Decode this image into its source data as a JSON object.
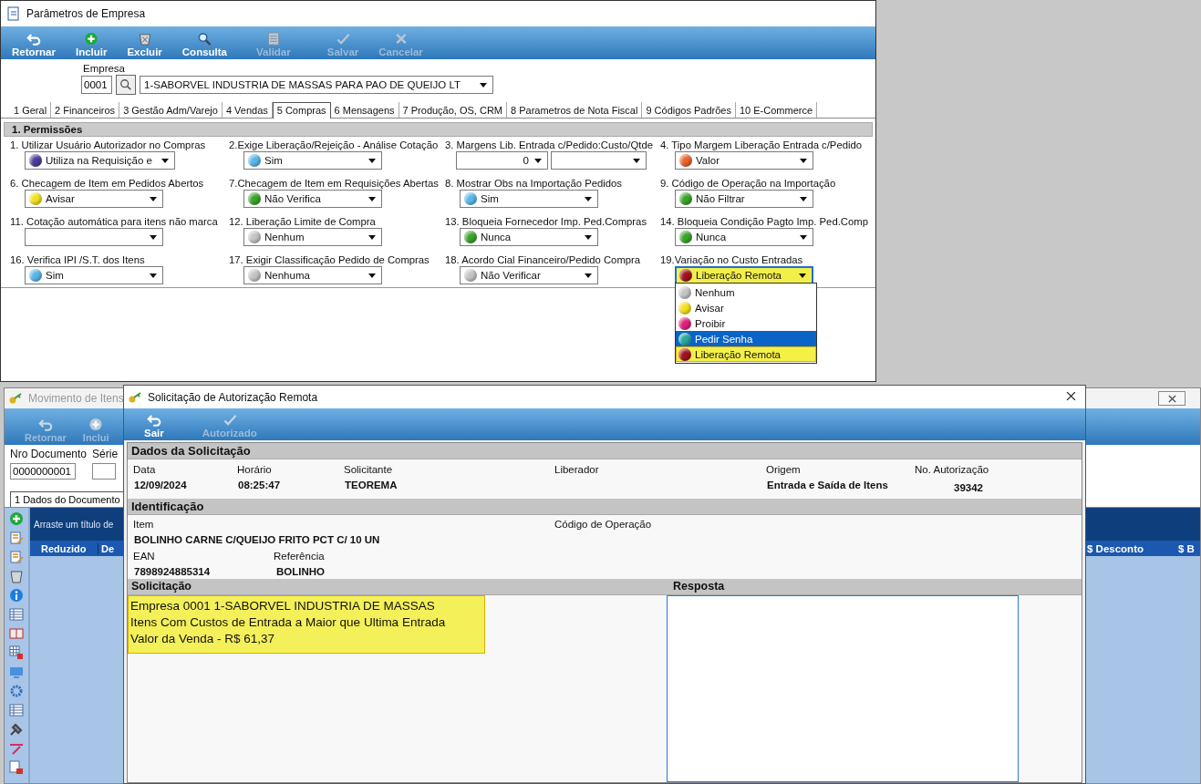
{
  "main_window": {
    "title": "Parâmetros de Empresa",
    "toolbar": [
      {
        "label": "Retornar",
        "kind": "undo",
        "disabled": false
      },
      {
        "label": "Incluir",
        "kind": "add",
        "disabled": false
      },
      {
        "label": "Excluir",
        "kind": "delete",
        "disabled": false
      },
      {
        "label": "Consulta",
        "kind": "search",
        "disabled": false
      },
      {
        "label": "Validar",
        "kind": "validate",
        "disabled": true
      },
      {
        "label": "Salvar",
        "kind": "check",
        "disabled": true
      },
      {
        "label": "Cancelar",
        "kind": "cancel",
        "disabled": true
      }
    ],
    "empresa": {
      "label": "Empresa",
      "code": "0001",
      "name": "1-SABORVEL INDUSTRIA DE MASSAS PARA PAO DE QUEIJO LT"
    },
    "tabs": [
      {
        "label": "1 Geral",
        "selected": false
      },
      {
        "label": "2 Financeiros",
        "selected": false
      },
      {
        "label": "3 Gestão Adm/Varejo",
        "selected": false
      },
      {
        "label": "4 Vendas",
        "selected": false
      },
      {
        "label": "5 Compras",
        "selected": true
      },
      {
        "label": "6 Mensagens",
        "selected": false
      },
      {
        "label": "7 Produção, OS, CRM",
        "selected": false
      },
      {
        "label": "8 Parametros de Nota Fiscal",
        "selected": false
      },
      {
        "label": "9 Códigos Padrões",
        "selected": false
      },
      {
        "label": "10 E-Commerce",
        "selected": false
      }
    ],
    "section": "1. Permissões",
    "fields": [
      {
        "label": "1. Utilizar Usuário Autorizador no Compras",
        "kind": "select",
        "value": "Utiliza na Requisição e",
        "color": "#4a3d9c"
      },
      {
        "label": "2.Exige Liberação/Rejeição - Análise Cotação",
        "kind": "select",
        "value": "Sim",
        "color": "#5ab6ea"
      },
      {
        "label": "3. Margens Lib. Entrada c/Pedido:Custo/Qtde",
        "kind": "pair",
        "value": "0"
      },
      {
        "label": "4. Tipo Margem Liberação Entrada c/Pedido",
        "kind": "select",
        "value": "Valor",
        "color": "#e8622a"
      },
      {
        "label": "6. Checagem de Item em Pedidos Abertos",
        "kind": "select",
        "value": "Avisar",
        "color": "#f2e01a"
      },
      {
        "label": "7.Checagem de Item em Requisições Abertas",
        "kind": "select",
        "value": "Não Verifica",
        "color": "#3aa52a"
      },
      {
        "label": "8. Mostrar Obs na Importação Pedidos",
        "kind": "select",
        "value": "Sim",
        "color": "#5ab6ea"
      },
      {
        "label": "9. Código de Operação na Importação",
        "kind": "select",
        "value": "Não Filtrar",
        "color": "#3aa52a"
      },
      {
        "label": "11. Cotação automática para itens não marca",
        "kind": "select"
      },
      {
        "label": "12. Liberação Limite de Compra",
        "kind": "select",
        "value": "Nenhum",
        "color": "#c4c4c4"
      },
      {
        "label": "13. Bloqueia Fornecedor Imp. Ped.Compras",
        "kind": "select",
        "value": "Nunca",
        "color": "#3aa52a"
      },
      {
        "label": "14. Bloqueia Condição Pagto Imp. Ped.Comp",
        "kind": "select",
        "value": "Nunca",
        "color": "#3aa52a"
      },
      {
        "label": "16. Verifica IPI /S.T. dos Itens",
        "kind": "select",
        "value": "Sim",
        "color": "#5ab6ea"
      },
      {
        "label": "17. Exigir Classificação Pedido de Compras",
        "kind": "select",
        "value": "Nenhuma",
        "color": "#c4c4c4"
      },
      {
        "label": "18. Acordo Cial Financeiro/Pedido Compra",
        "kind": "select",
        "value": "Não Verificar",
        "color": "#c4c4c4"
      },
      {
        "label": "19.Variação no Custo Entradas",
        "kind": "open",
        "value": "Liberação Remota",
        "color": "#a0141e",
        "options": [
          {
            "label": "Nenhum",
            "color": "#c4c4c4",
            "highlighted": false,
            "selected": false
          },
          {
            "label": "Avisar",
            "color": "#f2e01a",
            "highlighted": false,
            "selected": false
          },
          {
            "label": "Proibir",
            "color": "#e0207a",
            "highlighted": false,
            "selected": false
          },
          {
            "label": "Pedir Senha",
            "color": "#2aa8a0",
            "highlighted": true,
            "selected": false
          },
          {
            "label": "Liberação Remota",
            "color": "#a0141e",
            "highlighted": false,
            "selected": true
          }
        ]
      }
    ]
  },
  "back_window": {
    "title": "Movimento de Itens",
    "toolbar": [
      {
        "label": "Retornar",
        "kind": "undo"
      },
      {
        "label": "Inclui",
        "kind": "add"
      }
    ],
    "doc_label": "Nro Documento",
    "doc_value": "0000000001",
    "serie_label": "Série",
    "tab": "1 Dados do Documento",
    "grid_hint": "Arraste um título de",
    "columns": [
      "Reduzido",
      "De",
      "$ Desconto",
      "$ B"
    ]
  },
  "dialog": {
    "title": "Solicitação de Autorização Remota",
    "toolbar": [
      {
        "label": "Sair",
        "kind": "undo",
        "disabled": false
      },
      {
        "label": "Autorizado",
        "kind": "check",
        "disabled": true
      }
    ],
    "dados": {
      "title": "Dados da Solicitação",
      "fields": [
        {
          "label": "Data",
          "value": "12/09/2024"
        },
        {
          "label": "Horário",
          "value": "08:25:47"
        },
        {
          "label": "Solicitante",
          "value": "TEOREMA"
        },
        {
          "label": "Liberador"
        },
        {
          "label": "Origem",
          "value": "Entrada e Saída de Itens"
        },
        {
          "label": "No. Autorização",
          "value": "39342"
        }
      ]
    },
    "identificacao": {
      "title": "Identificação",
      "item": {
        "label": "Item",
        "value": "BOLINHO CARNE C/QUEIJO FRITO PCT C/ 10 UN"
      },
      "codigo_operacao": {
        "label": "Código de Operação"
      },
      "ean": {
        "label": "EAN",
        "value": "7898924885314"
      },
      "referencia": {
        "label": "Referência",
        "value": "BOLINHO"
      }
    },
    "solicitacao": {
      "title": "Solicitação",
      "lines": [
        "Empresa 0001 1-SABORVEL INDUSTRIA DE MASSAS",
        "Itens Com Custos de Entrada a Maior que Ultima Entrada",
        "Valor da Venda - R$ 61,37"
      ]
    },
    "resposta": {
      "title": "Resposta"
    }
  }
}
